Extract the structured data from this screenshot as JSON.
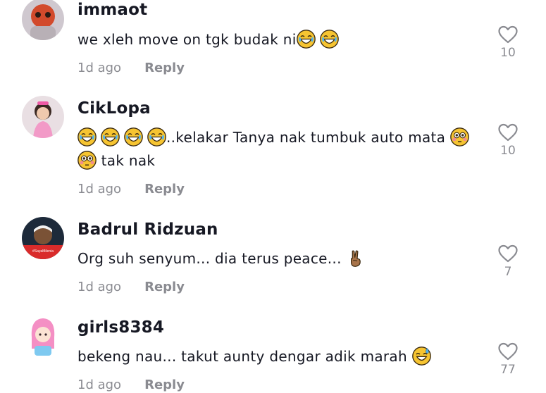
{
  "comments": [
    {
      "username": "immaot",
      "text_before": "we xleh move on tgk budak ni",
      "time": "1d ago",
      "reply_label": "Reply",
      "likes": "10"
    },
    {
      "username": "CikLopa",
      "text_before": "..kelakar Tanya nak tumbuk auto mata ",
      "text_after": " tak nak",
      "time": "1d ago",
      "reply_label": "Reply",
      "likes": "10"
    },
    {
      "username": "Badrul Ridzuan",
      "text_before": "Org suh senyum... dia terus peace... ",
      "avatar_text": "#SayaMilenia",
      "time": "1d ago",
      "reply_label": "Reply",
      "likes": "7"
    },
    {
      "username": "girls8384",
      "text_before": "bekeng nau... takut aunty dengar adik marah ",
      "time": "1d ago",
      "reply_label": "Reply",
      "likes": "77"
    }
  ],
  "emoji_icons": [
    "joy-emoji",
    "flushed-emoji",
    "victory-hand-emoji",
    "sweat-smile-emoji"
  ],
  "colors": {
    "text": "#161823",
    "muted": "#8a8b91",
    "emoji": "#f6c431"
  }
}
